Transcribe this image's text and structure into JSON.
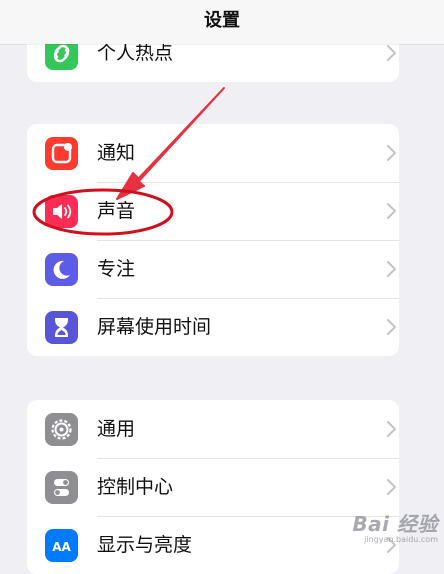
{
  "nav": {
    "title": "设置"
  },
  "groups": [
    {
      "rows": [
        {
          "label": "个人热点",
          "icon": "hotspot-icon",
          "color": "#34c759"
        }
      ]
    },
    {
      "rows": [
        {
          "label": "通知",
          "icon": "notification-icon",
          "color": "#ff3b30"
        },
        {
          "label": "声音",
          "icon": "speaker-icon",
          "color": "#ff2d55"
        },
        {
          "label": "专注",
          "icon": "moon-icon",
          "color": "#5e5ce6"
        },
        {
          "label": "屏幕使用时间",
          "icon": "hourglass-icon",
          "color": "#5856d6"
        }
      ]
    },
    {
      "rows": [
        {
          "label": "通用",
          "icon": "gear-icon",
          "color": "#8e8e93"
        },
        {
          "label": "控制中心",
          "icon": "toggles-icon",
          "color": "#8e8e93"
        },
        {
          "label": "显示与亮度",
          "icon": "text-size-icon",
          "color": "#007aff"
        }
      ]
    }
  ],
  "annotation": {
    "arrow_color": "#e8313e",
    "ellipse_color": "#d0101c"
  },
  "watermark": {
    "main": "Bai 经验",
    "sub": "jingyan.baidu.com"
  }
}
